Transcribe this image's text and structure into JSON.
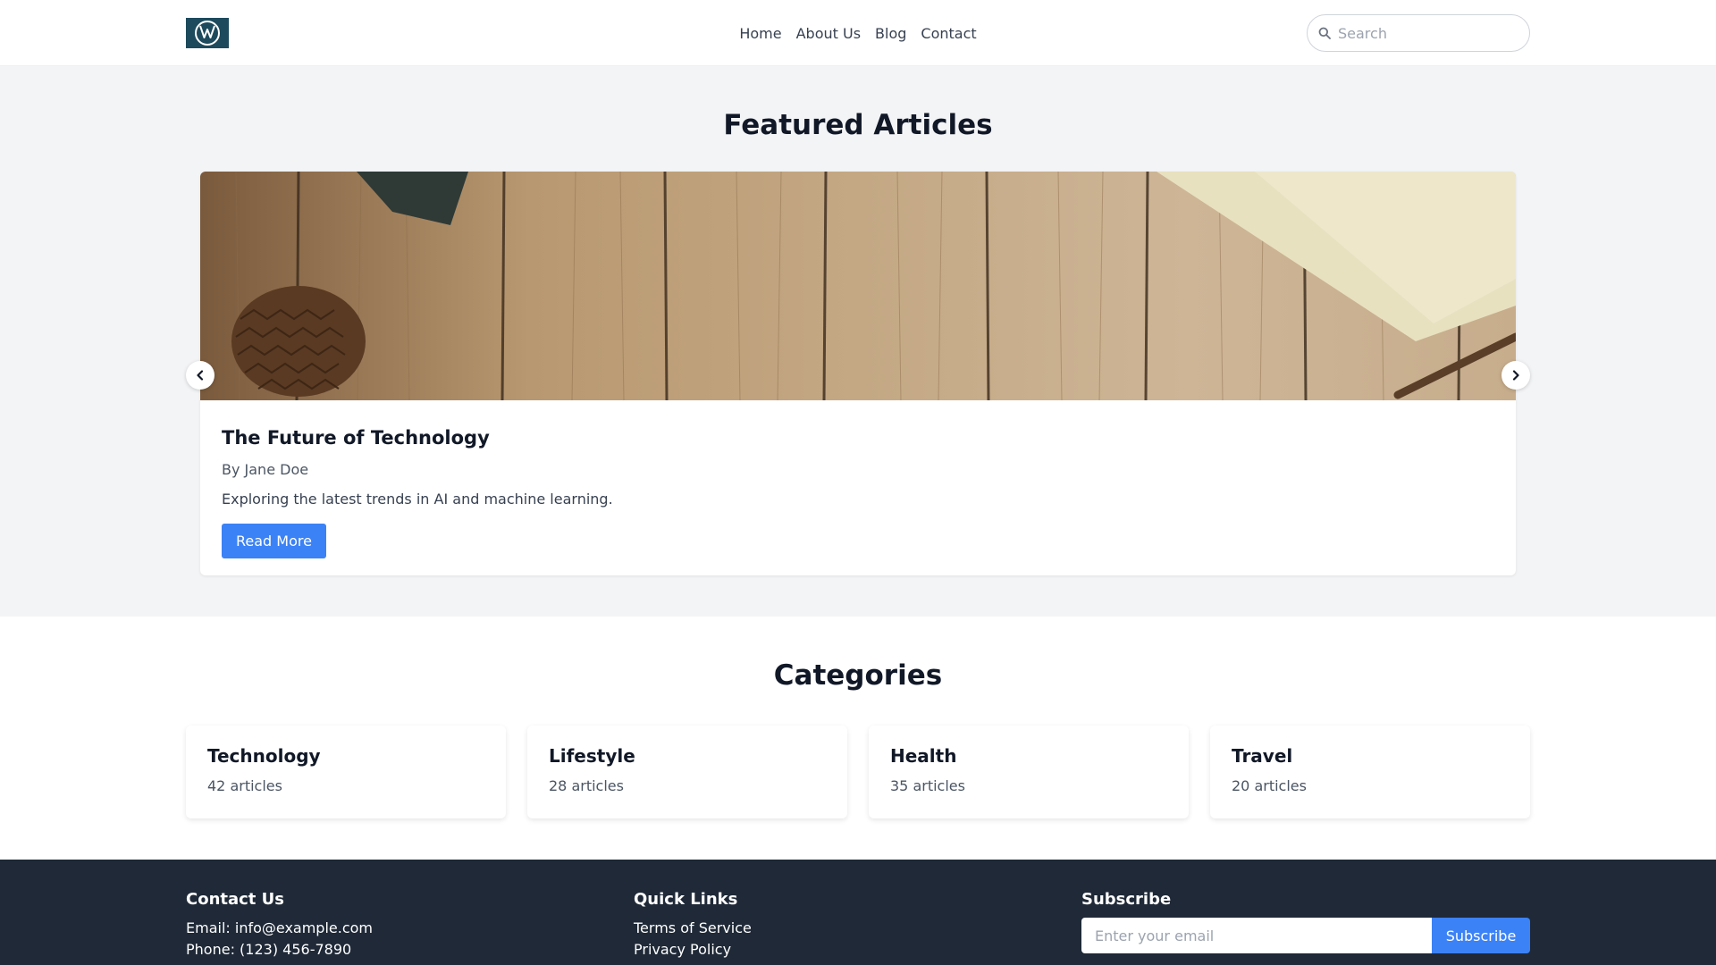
{
  "header": {
    "logo_alt": "VW",
    "nav": [
      {
        "label": "Home"
      },
      {
        "label": "About Us"
      },
      {
        "label": "Blog"
      },
      {
        "label": "Contact"
      }
    ],
    "search": {
      "placeholder": "Search",
      "value": ""
    }
  },
  "featured": {
    "title": "Featured Articles",
    "article": {
      "title": "The Future of Technology",
      "author": "By Jane Doe",
      "excerpt": "Exploring the latest trends in AI and machine learning.",
      "button_label": "Read More"
    },
    "prev_icon": "chevron-left-icon",
    "next_icon": "chevron-right-icon"
  },
  "categories": {
    "title": "Categories",
    "items": [
      {
        "name": "Technology",
        "count": "42 articles"
      },
      {
        "name": "Lifestyle",
        "count": "28 articles"
      },
      {
        "name": "Health",
        "count": "35 articles"
      },
      {
        "name": "Travel",
        "count": "20 articles"
      }
    ]
  },
  "footer": {
    "contact": {
      "title": "Contact Us",
      "email": "Email: info@example.com",
      "phone": "Phone: (123) 456-7890"
    },
    "links": {
      "title": "Quick Links",
      "items": [
        {
          "label": "Terms of Service"
        },
        {
          "label": "Privacy Policy"
        }
      ]
    },
    "subscribe": {
      "title": "Subscribe",
      "placeholder": "Enter your email",
      "value": "",
      "button_label": "Subscribe"
    }
  },
  "colors": {
    "accent": "#3b82f6",
    "footer_bg": "#1f2937",
    "section_bg": "#f3f4f6",
    "logo_bg": "#1d4a5c"
  }
}
